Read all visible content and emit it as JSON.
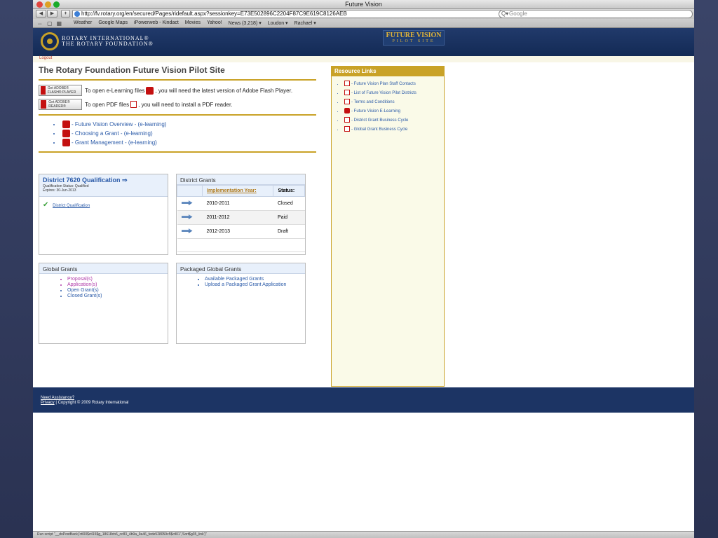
{
  "window": {
    "title": "Future Vision"
  },
  "toolbar": {
    "url": "http://fv.rotary.org/en/secured/Pages/ridefault.aspx?sessionkey=E73E502896C2204F87C9E619C8126AEB",
    "search_placeholder": "Google"
  },
  "bookmarks": [
    "Weather",
    "Google Maps",
    "iPowerweb - Kindact",
    "Movies",
    "Yahoo!",
    "News (3,218) ▾",
    "Loudon ▾",
    "Rachael ▾"
  ],
  "header": {
    "org_line1": "ROTARY INTERNATIONAL®",
    "org_line2": "THE ROTARY FOUNDATION®",
    "badge_title": "FUTURE VISION",
    "badge_sub": "PILOT SITE"
  },
  "logout": "Logout",
  "page_title": "The Rotary Foundation Future Vision Pilot Site",
  "flash": {
    "button_label": "Get ADOBE® FLASH® PLAYER",
    "text_a": "To open e-Learning files",
    "text_b": ", you will need the latest version of Adobe Flash Player."
  },
  "pdf": {
    "button_label": "Get ADOBE® READER®",
    "text_a": "To open PDF files",
    "text_b": ", you will need to install a PDF reader."
  },
  "elearning": [
    "- Future Vision Overview - (e-learning)",
    "- Choosing a Grant - (e-learning)",
    "- Grant Management - (e-learning)"
  ],
  "district_qual": {
    "title": "District 7620 Qualification ⇒",
    "status": "Qualification Status: Qualified",
    "expires": "Expires: 30-Jun-2013",
    "link": "District Qualification"
  },
  "district_grants": {
    "title": "District Grants",
    "col_year": "Implementation Year:",
    "col_status": "Status:",
    "rows": [
      {
        "year": "2010-2011",
        "status": "Closed"
      },
      {
        "year": "2011-2012",
        "status": "Paid"
      },
      {
        "year": "2012-2013",
        "status": "Draft"
      }
    ]
  },
  "global_grants": {
    "title": "Global Grants",
    "items": [
      "Proposal(s)",
      "Application(s)",
      "Open Grant(s)",
      "Closed Grant(s)"
    ]
  },
  "packaged_grants": {
    "title": "Packaged Global Grants",
    "items": [
      "Available Packaged Grants",
      "Upload a Packaged Grant Application"
    ]
  },
  "resources": {
    "title": "Resource Links",
    "items": [
      "- Future Vision Plan Staff Contacts",
      "- List of Future Vision Pilot Districts",
      "- Terms and Conditions",
      "- Future Vision E-Learning",
      "- District Grant Business Cycle",
      "- Global Grant Business Cycle"
    ]
  },
  "footer": {
    "assist": "Need Assistance?",
    "privacy": "Privacy",
    "copyright": " | Copyright © 2009 Rotary International"
  },
  "status_bar": "Run script \"__doPostBack('ctl00$ctl15$g_18618cb6_cc83_4b9a_9a46_fede528059c5$ctl01','Sort$g35_link')\""
}
